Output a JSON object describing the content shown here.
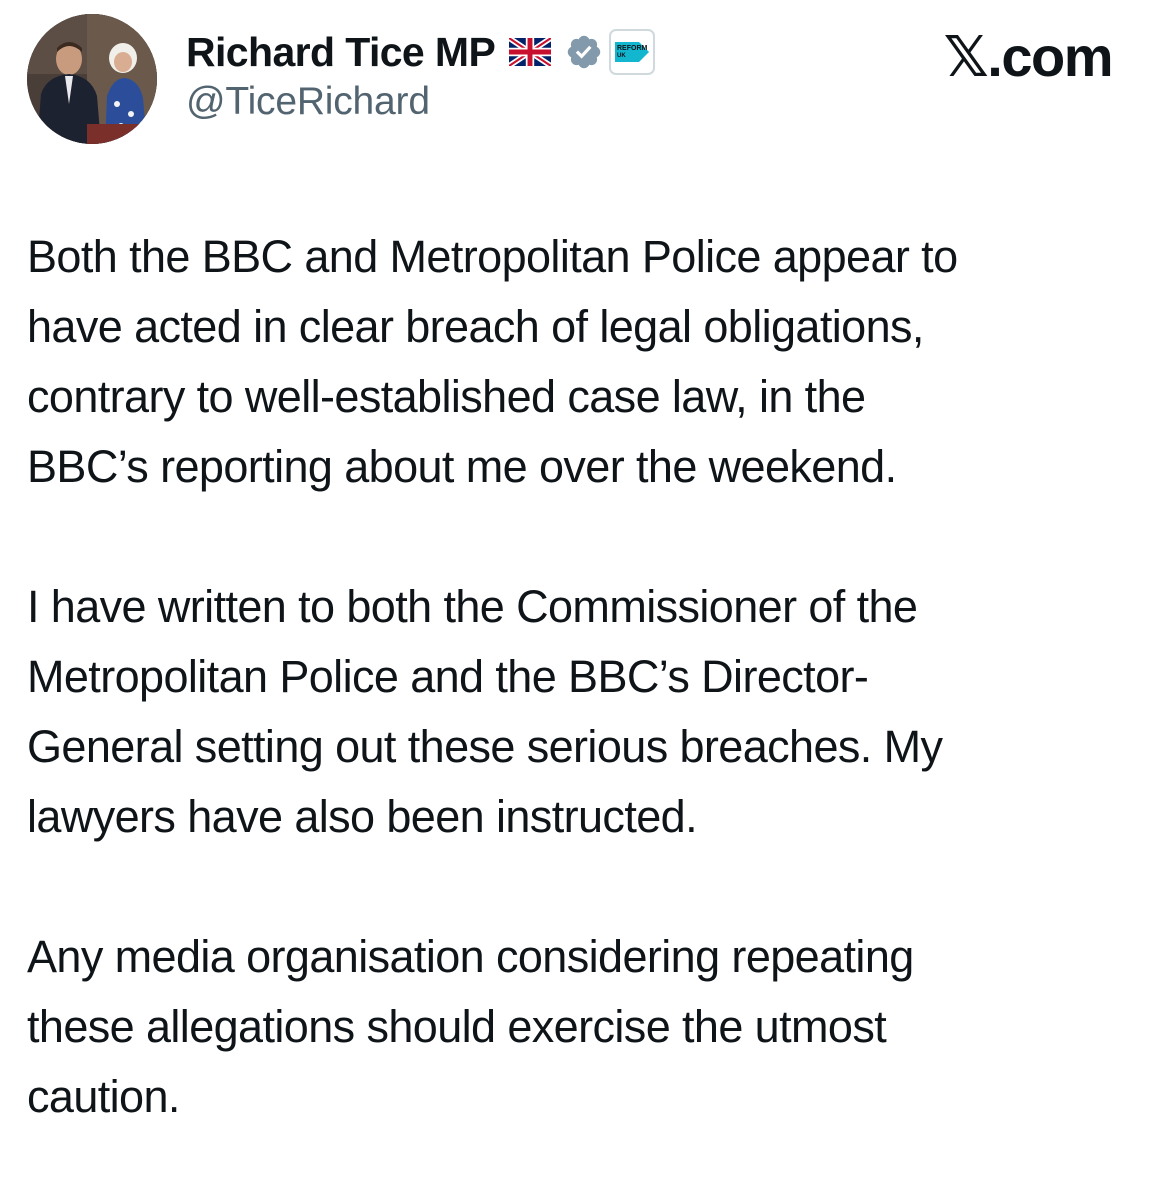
{
  "header": {
    "display_name": "Richard Tice MP",
    "handle": "@TiceRichard",
    "flag_icon": "uk-flag-icon",
    "verified_icon": "verified-badge-icon",
    "verified_color": "#829aab",
    "affiliate_badge": {
      "icon": "reform-uk-affiliate-icon",
      "text_line1": "REFORM",
      "text_line2": "UK",
      "color": "#12b6cf"
    }
  },
  "brand": {
    "label": "𝕏.com"
  },
  "tweet": {
    "paragraphs": [
      "Both the BBC and Metropolitan Police appear to\nhave acted in clear breach of legal obligations,\ncontrary to well-established case law, in the\nBBC’s reporting about me over the weekend.",
      "I have written to both the Commissioner of the\nMetropolitan Police and the BBC’s Director-\nGeneral setting out these serious breaches. My\nlawyers have also been instructed.",
      "Any media organisation considering repeating\nthese allegations should exercise the utmost\ncaution."
    ]
  },
  "colors": {
    "text_primary": "#0f1419",
    "text_secondary": "#536471",
    "background": "#ffffff"
  }
}
